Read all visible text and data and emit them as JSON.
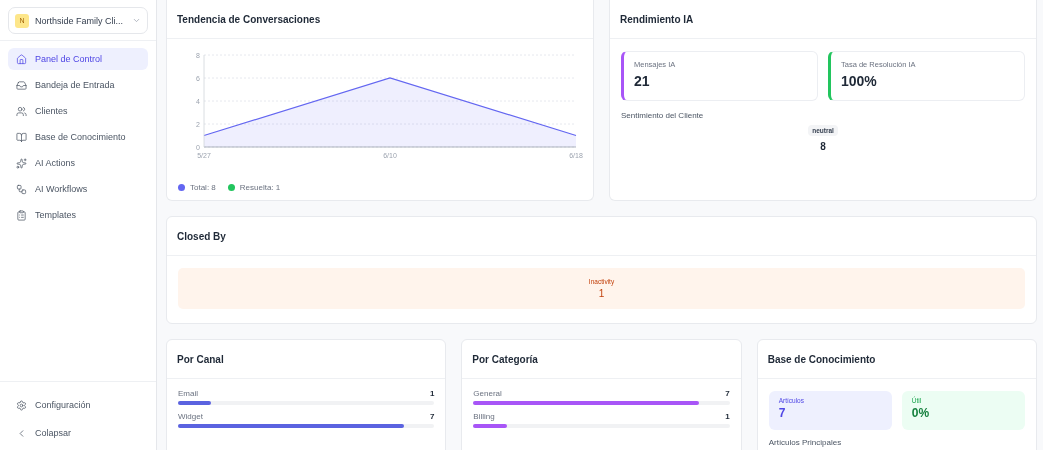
{
  "org_selector": {
    "initial": "N",
    "name": "Northside Family Cli..."
  },
  "sidebar": {
    "items": [
      {
        "label": "Panel de Control",
        "selected": true
      },
      {
        "label": "Bandeja de Entrada",
        "selected": false
      },
      {
        "label": "Clientes",
        "selected": false
      },
      {
        "label": "Base de Conocimiento",
        "selected": false
      },
      {
        "label": "AI Actions",
        "selected": false
      },
      {
        "label": "AI Workflows",
        "selected": false
      },
      {
        "label": "Templates",
        "selected": false
      }
    ],
    "footer": [
      {
        "label": "Configuración"
      },
      {
        "label": "Colapsar"
      }
    ]
  },
  "trend": {
    "title": "Tendencia de Conversaciones",
    "chart_data": {
      "type": "area",
      "categories": [
        "5/27",
        "6/10",
        "6/18"
      ],
      "yticks": [
        0,
        2,
        4,
        6,
        8
      ],
      "ylim": [
        0,
        8
      ],
      "grid": true,
      "series": [
        {
          "color": "#6366f1",
          "values": [
            1,
            6,
            1
          ]
        }
      ]
    },
    "legend": [
      {
        "label": "Total: 8",
        "color": "#6366f1"
      },
      {
        "label": "Resuelta: 1",
        "color": "#22c55e"
      }
    ]
  },
  "ai_performance": {
    "title": "Rendimiento IA",
    "stats": [
      {
        "label": "Mensajes IA",
        "value": "21",
        "color": "#a855f7"
      },
      {
        "label": "Tasa de Resolución IA",
        "value": "100%",
        "color": "#22c55e"
      }
    ],
    "sentiment_label": "Sentimiento del Cliente",
    "sentiment": {
      "tag": "neutral",
      "count": "8"
    }
  },
  "closed_by": {
    "title": "Closed By",
    "items": [
      {
        "label": "Inactivity",
        "value": "1"
      }
    ]
  },
  "by_channel": {
    "title": "Por Canal",
    "rows": [
      {
        "label": "Email",
        "count": "1",
        "level": 0.13
      },
      {
        "label": "Widget",
        "count": "7",
        "level": 0.88
      }
    ],
    "color": "#5b63e0"
  },
  "by_category": {
    "title": "Por Categoría",
    "rows": [
      {
        "label": "General",
        "count": "7",
        "level": 0.88
      },
      {
        "label": "Billing",
        "count": "1",
        "level": 0.13
      }
    ],
    "color": "#a855f7"
  },
  "knowledge": {
    "title": "Base de Conocimiento",
    "stats": [
      {
        "label": "Artículos",
        "value": "7",
        "kind": "articles"
      },
      {
        "label": "Útil",
        "value": "0%",
        "kind": "useful"
      }
    ],
    "subtitle": "Artículos Principales"
  }
}
